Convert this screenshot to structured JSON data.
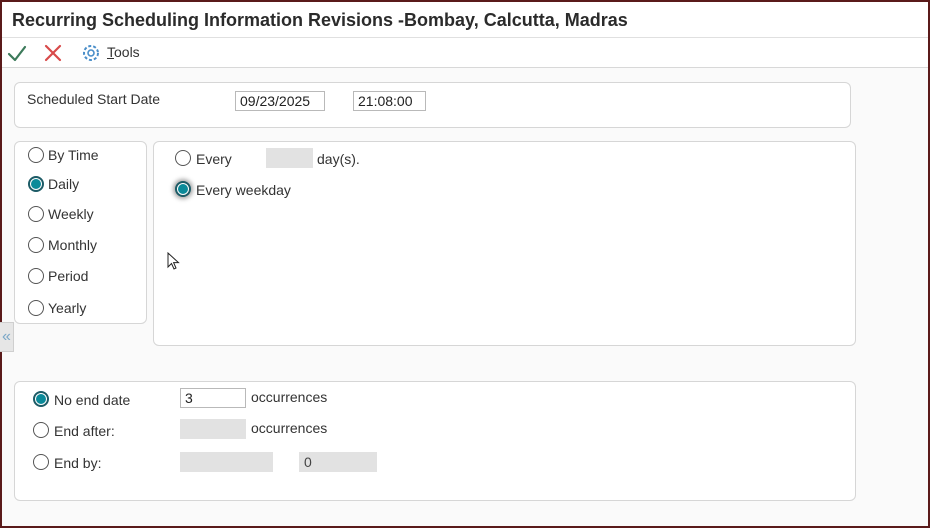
{
  "window": {
    "title": "Recurring Scheduling Information Revisions -Bombay, Calcutta, Madras"
  },
  "toolbar": {
    "ok_icon": "checkmark-icon",
    "cancel_icon": "close-icon",
    "tools_icon": "gear-icon",
    "tools_label_accel": "T",
    "tools_label_rest": "ools"
  },
  "schedule": {
    "start_label": "Scheduled Start Date",
    "start_date": "09/23/2025",
    "start_time": "21:08:00"
  },
  "frequency": {
    "options": [
      "By Time",
      "Daily",
      "Weekly",
      "Monthly",
      "Period",
      "Yearly"
    ],
    "selected": "Daily"
  },
  "daily": {
    "every_label": "Every",
    "days_value": "",
    "days_suffix": "day(s).",
    "weekday_label": "Every weekday",
    "selected": "Every weekday"
  },
  "end": {
    "no_end_label": "No end date",
    "no_end_occurrences": "3",
    "occurrences_label": "occurrences",
    "end_after_label": "End after:",
    "end_after_value": "",
    "end_after_occurrences_label": "occurrences",
    "end_by_label": "End by:",
    "end_by_date": "",
    "end_by_time": "0",
    "selected": "No end date"
  },
  "colors": {
    "radio_selected": "#0b8a99",
    "title_border": "#5a1a1a",
    "check_green": "#3c7a5a",
    "cancel_red": "#d84a4a",
    "gear_blue": "#4a8ec9"
  }
}
